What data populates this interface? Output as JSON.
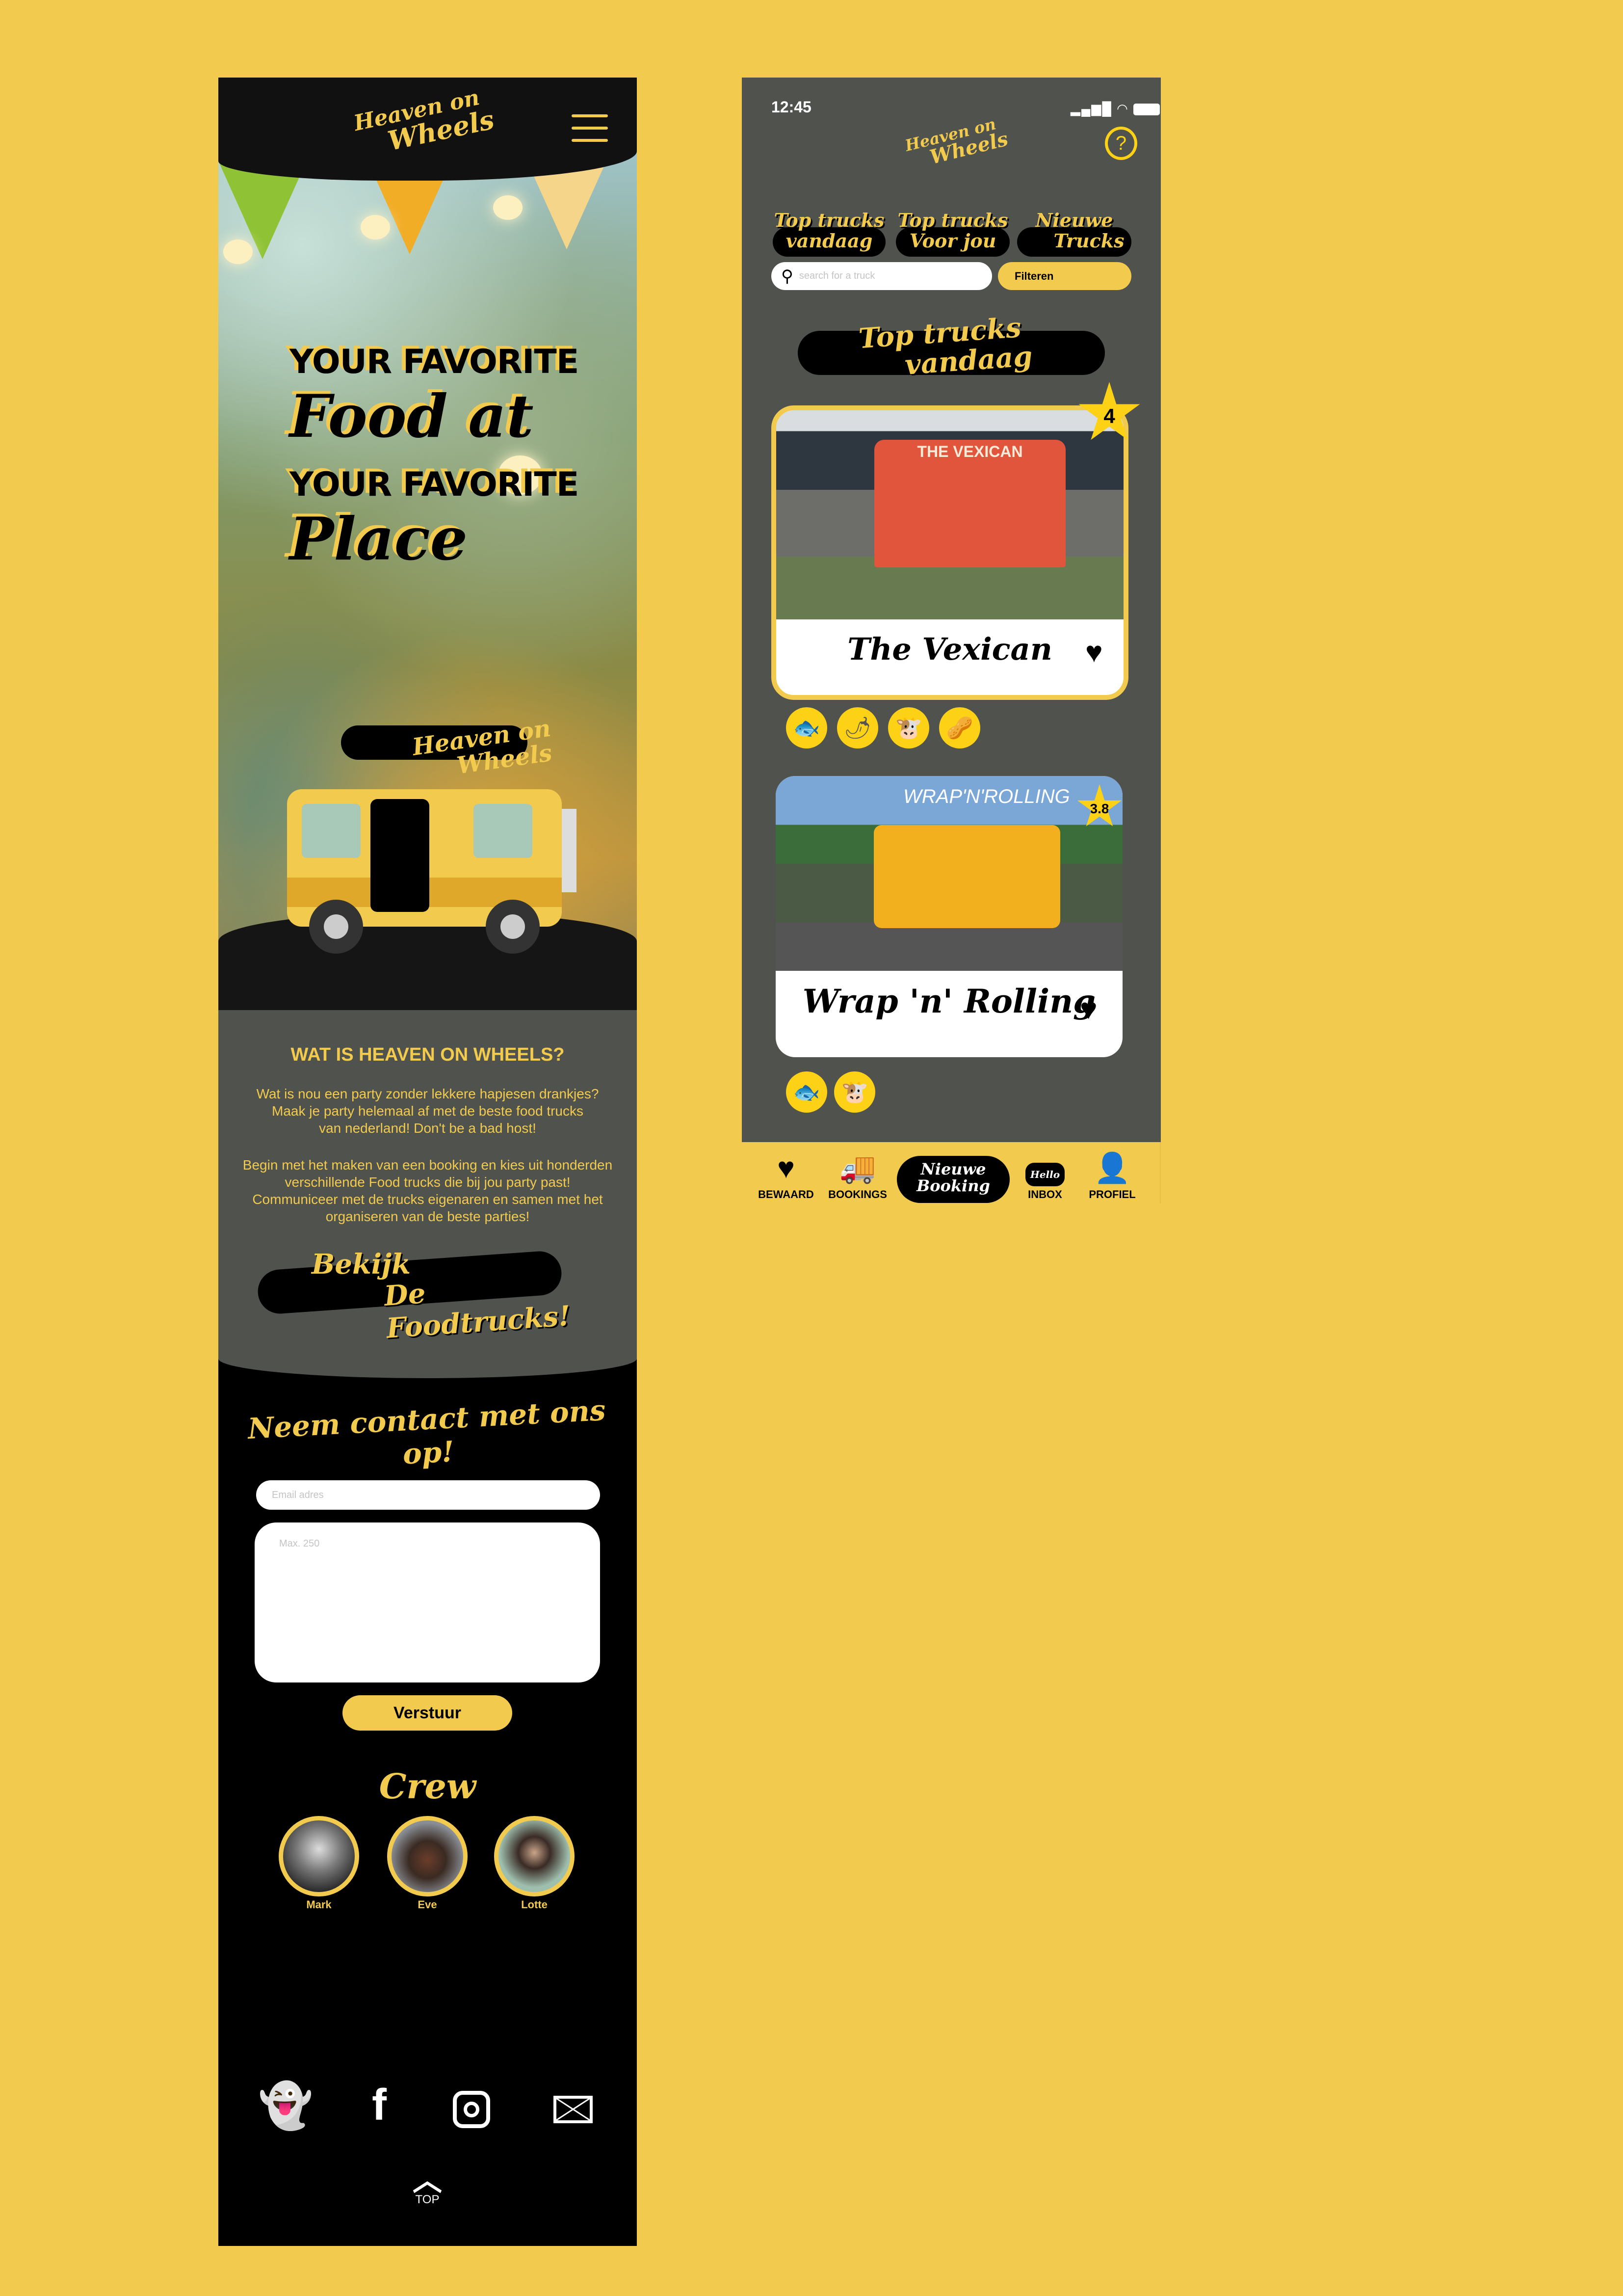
{
  "website": {
    "logo": {
      "line1": "Heaven on",
      "line2": "Wheels"
    },
    "menu_icon": "hamburger-icon",
    "hero": {
      "line1": "YOUR FAVORITE",
      "line2": "Food at",
      "line3": "YOUR FAVORITE",
      "line4": "Place"
    },
    "truck_logo": {
      "line1": "Heaven on",
      "line2": "Wheels"
    },
    "about": {
      "title": "WAT IS HEAVEN  ON WHEELS?",
      "p1": [
        "Wat is nou een party zonder lekkere hapjesen drankjes?",
        "Maak je party helemaal af met de beste food trucks",
        "van nederland!  Don't be a bad host!"
      ],
      "p2": [
        "Begin met het maken van een booking en kies uit honderden",
        "verschillende Food trucks die bij jou party past!",
        "Communiceer met de trucks eigenaren en samen met het",
        "organiseren van de beste parties!"
      ]
    },
    "cta": {
      "line1": "Bekijk",
      "line2": "De Foodtrucks!"
    },
    "contact": {
      "title": "Neem contact met ons op!",
      "email_placeholder": "Email adres",
      "message_placeholder": "Max. 250",
      "submit": "Verstuur"
    },
    "crew": {
      "title": "Crew",
      "members": [
        {
          "name": "Mark"
        },
        {
          "name": "Eve"
        },
        {
          "name": "Lotte"
        }
      ]
    },
    "social": [
      "snapchat-icon",
      "facebook-icon",
      "instagram-icon",
      "mail-icon"
    ],
    "top_label": "TOP"
  },
  "app": {
    "status": {
      "time": "12:45"
    },
    "logo": {
      "line1": "Heaven on",
      "line2": "Wheels"
    },
    "tabs": [
      {
        "l1": "Top trucks",
        "l2": "vandaag"
      },
      {
        "l1": "Top trucks",
        "l2": "Voor jou"
      },
      {
        "l1": "Nieuwe",
        "l2": "Trucks"
      }
    ],
    "search": {
      "placeholder": "search for a truck",
      "filter": "Filteren"
    },
    "section": {
      "l1": "Top trucks",
      "l2": "vandaag"
    },
    "trucks": [
      {
        "name": "The Vexican",
        "sign": "THE VEXICAN",
        "rating": "4",
        "tags": [
          "meat-fish-icon",
          "chili-icon",
          "cow-icon",
          "peanut-icon"
        ]
      },
      {
        "name": "Wrap 'n' Rolling",
        "sign": "WRAP'N'ROLLING",
        "rating": "3.8",
        "tags": [
          "meat-fish-icon",
          "cow-icon"
        ]
      }
    ],
    "nav": [
      {
        "label": "BEWAARD"
      },
      {
        "label": "BOOKINGS"
      },
      {
        "l1": "Nieuwe",
        "l2": "Booking"
      },
      {
        "label": "INBOX",
        "bubble": "Hello"
      },
      {
        "label": "PROFIEL"
      }
    ],
    "colors": {
      "accent": "#f2cb4e",
      "star": "#fcd116",
      "panel": "#50524d"
    }
  }
}
